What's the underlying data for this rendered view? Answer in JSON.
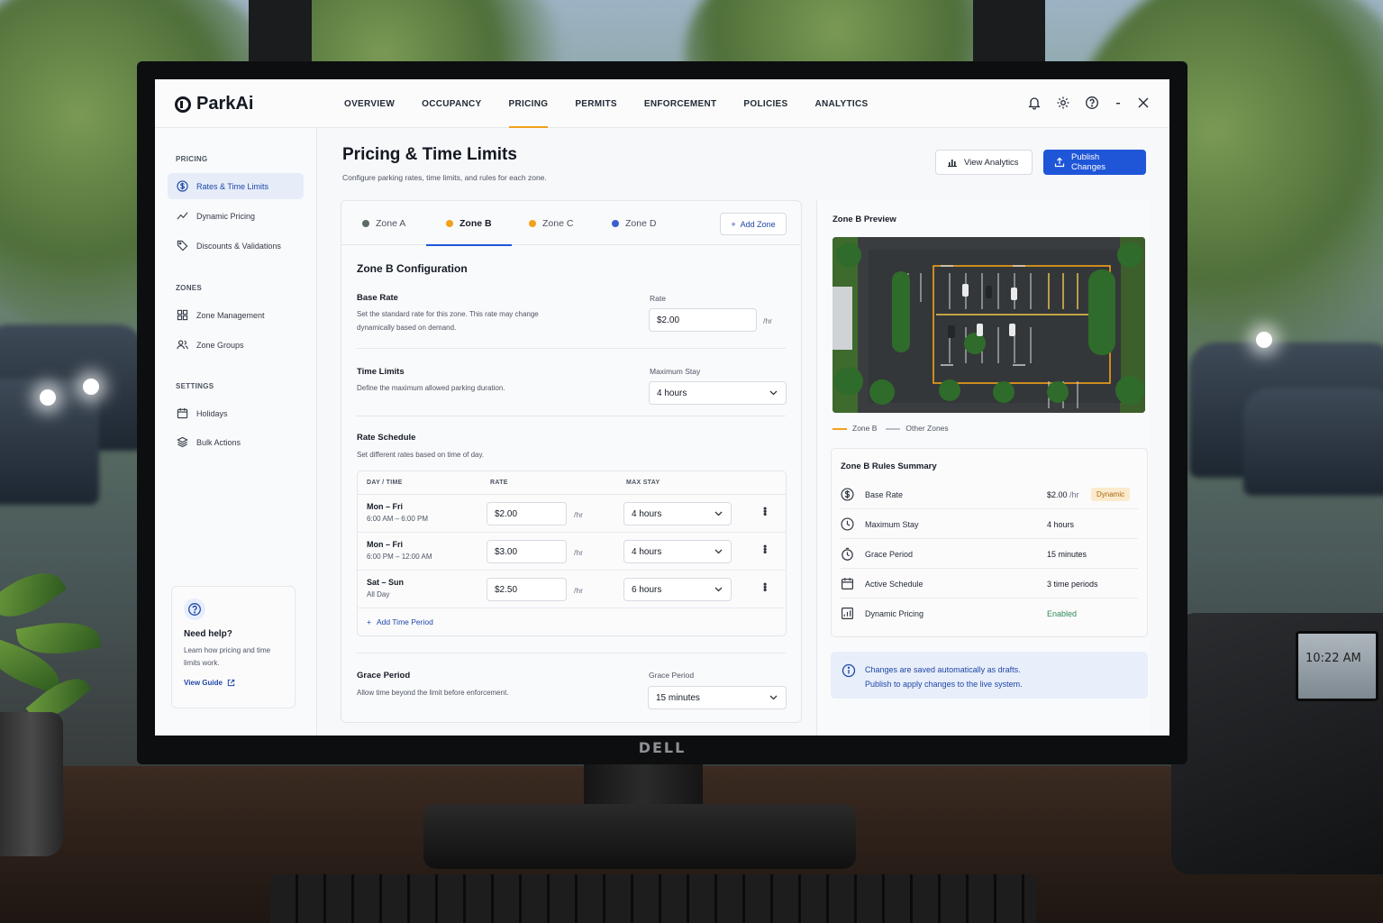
{
  "app": {
    "name": "ParkAi"
  },
  "nav": {
    "items": [
      "OVERVIEW",
      "OCCUPANCY",
      "PRICING",
      "PERMITS",
      "ENFORCEMENT",
      "POLICIES",
      "ANALYTICS"
    ],
    "active": "PRICING"
  },
  "top_icons": [
    "bell-icon",
    "gear-icon",
    "help-icon",
    "minimize-icon",
    "close-icon"
  ],
  "sidebar": {
    "pricing_label": "PRICING",
    "pricing_items": [
      "Rates & Time Limits",
      "Dynamic Pricing",
      "Discounts & Validations"
    ],
    "zones_label": "ZONES",
    "zones_items": [
      "Zone Management",
      "Zone Groups"
    ],
    "settings_label": "SETTINGS",
    "settings_items": [
      "Holidays",
      "Bulk Actions"
    ],
    "help": {
      "title": "Need help?",
      "text": "Learn how pricing and time limits work.",
      "link": "View Guide"
    }
  },
  "header": {
    "title": "Pricing & Time Limits",
    "subtitle": "Configure parking rates, time limits, and rules for each zone.",
    "view_analytics": "View Analytics",
    "publish": "Publish Changes"
  },
  "zones": {
    "tabs": [
      {
        "label": "Zone A",
        "color": "#5d6b63"
      },
      {
        "label": "Zone B",
        "color": "#f2a11a"
      },
      {
        "label": "Zone C",
        "color": "#f2a11a"
      },
      {
        "label": "Zone D",
        "color": "#3a5fd0"
      }
    ],
    "active": "Zone B",
    "add_zone": "Add Zone"
  },
  "config": {
    "title": "Zone B Configuration",
    "base_rate": {
      "title": "Base Rate",
      "desc": "Set the standard rate for this zone. This rate may change dynamically based on demand.",
      "label": "Rate",
      "value": "$2.00",
      "unit": "/hr"
    },
    "time_limits": {
      "title": "Time Limits",
      "desc": "Define the maximum allowed parking duration.",
      "label": "Maximum Stay",
      "value": "4 hours"
    },
    "schedule": {
      "title": "Rate Schedule",
      "desc": "Set different rates based on time of day.",
      "headers": [
        "DAY / TIME",
        "RATE",
        "MAX STAY"
      ],
      "unit": "/hr",
      "rows": [
        {
          "day": "Mon – Fri",
          "time": "6:00 AM – 6:00 PM",
          "rate": "$2.00",
          "stay": "4 hours"
        },
        {
          "day": "Mon – Fri",
          "time": "6:00 PM – 12:00 AM",
          "rate": "$3.00",
          "stay": "4 hours"
        },
        {
          "day": "Sat – Sun",
          "time": "All Day",
          "rate": "$2.50",
          "stay": "6 hours"
        }
      ],
      "add_period": "Add Time Period"
    },
    "grace": {
      "title": "Grace Period",
      "desc": "Allow time beyond the limit before enforcement.",
      "label": "Grace Period",
      "value": "15 minutes"
    }
  },
  "preview": {
    "title": "Zone B Preview",
    "legend": [
      "Zone B",
      "Other Zones"
    ],
    "legend_colors": [
      "#f2a11a",
      "#b8bec7"
    ],
    "summary": {
      "title": "Zone B Rules Summary",
      "rows": [
        {
          "label": "Base Rate",
          "value": "$2.00",
          "unit": "/hr",
          "badge": "Dynamic",
          "icon": "dollar-icon"
        },
        {
          "label": "Maximum Stay",
          "value": "4 hours",
          "icon": "clock-icon"
        },
        {
          "label": "Grace Period",
          "value": "15 minutes",
          "icon": "timer-icon"
        },
        {
          "label": "Active Schedule",
          "value": "3 time periods",
          "icon": "calendar-icon"
        },
        {
          "label": "Dynamic Pricing",
          "value": "Enabled",
          "icon": "chart-icon"
        }
      ]
    },
    "info": {
      "line1": "Changes are saved automatically as drafts.",
      "line2": "Publish to apply changes to the live system."
    }
  },
  "environment": {
    "monitor_brand": "DELL",
    "phone_time": "10:22 AM"
  }
}
